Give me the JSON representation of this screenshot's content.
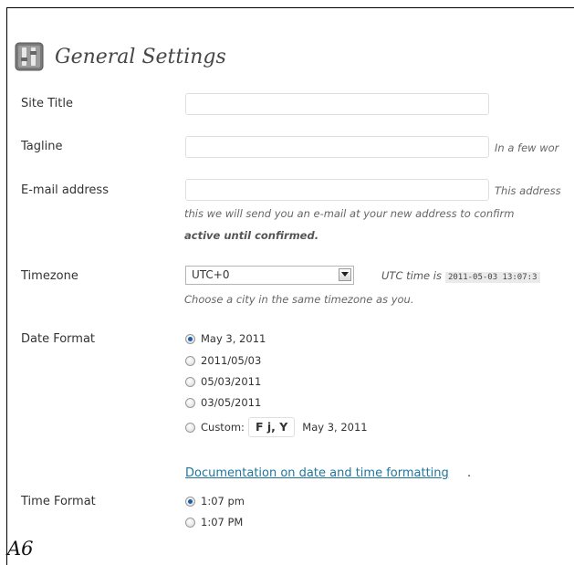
{
  "header": {
    "title": "General Settings"
  },
  "site_title": {
    "label": "Site Title",
    "value": ""
  },
  "tagline": {
    "label": "Tagline",
    "value": "",
    "description": "In a few wor"
  },
  "email": {
    "label": "E-mail address",
    "value": "",
    "description_inline": "This address",
    "description_line2": "this we will send you an e-mail at your new address to confirm",
    "description_line3": "active until confirmed."
  },
  "timezone": {
    "label": "Timezone",
    "selected": "UTC+0",
    "utc_label": "UTC time is",
    "utc_time": "2011-05-03 13:07:3",
    "hint": "Choose a city in the same timezone as you."
  },
  "date_format": {
    "label": "Date Format",
    "options": [
      "May 3, 2011",
      "2011/05/03",
      "05/03/2011",
      "03/05/2011"
    ],
    "custom_label": "Custom:",
    "custom_value": "F j, Y",
    "custom_preview": "May 3, 2011",
    "selected_index": 0,
    "doc_link": "Documentation on date and time formatting",
    "doc_link_suffix": "."
  },
  "time_format": {
    "label": "Time Format",
    "options": [
      "1:07 pm",
      "1:07 PM"
    ],
    "selected_index": 0
  },
  "caption": "A6",
  "colors": {
    "link": "#21759b",
    "radio_checked": "#1c5ea8"
  }
}
